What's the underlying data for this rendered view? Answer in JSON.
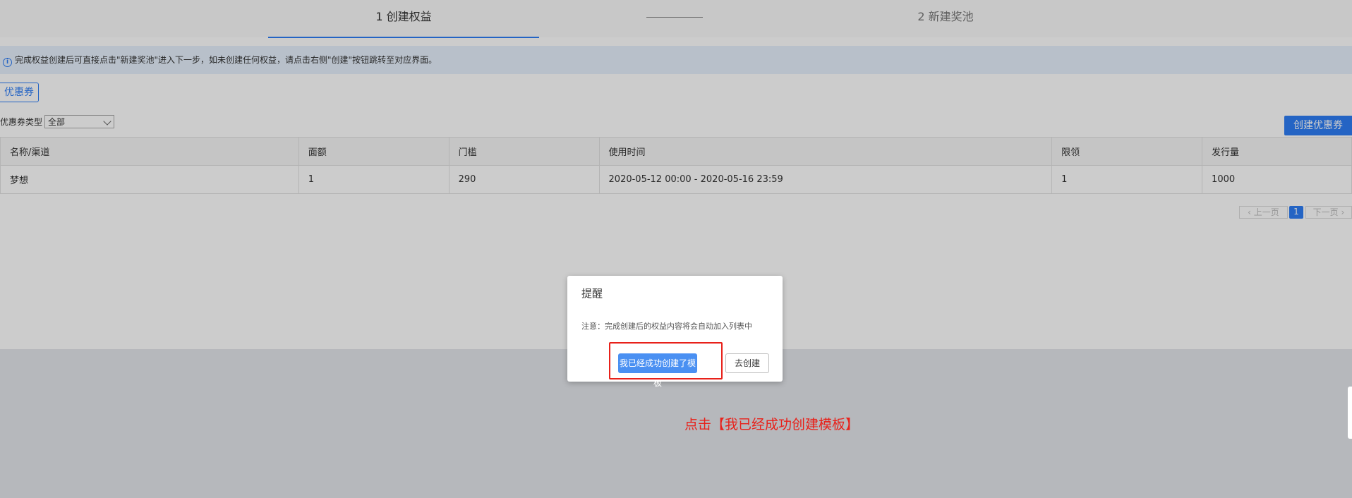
{
  "steps": {
    "step1": "1 创建权益",
    "step2": "2 新建奖池"
  },
  "info": {
    "icon": "info-icon",
    "text": "完成权益创建后可直接点击\"新建奖池\"进入下一步，如未创建任何权益，请点击右侧\"创建\"按钮跳转至对应界面。"
  },
  "tab": {
    "label": "优惠券"
  },
  "filter": {
    "label": "优惠券类型",
    "selected": "全部"
  },
  "toolbar": {
    "create_label": "创建优惠券"
  },
  "table": {
    "headers": [
      "名称/渠道",
      "面额",
      "门槛",
      "使用时间",
      "限领",
      "发行量"
    ],
    "rows": [
      [
        "梦想",
        "1",
        "290",
        "2020-05-12 00:00 - 2020-05-16 23:59",
        "1",
        "1000"
      ]
    ]
  },
  "pagination": {
    "prev": "上一页",
    "current": "1",
    "next": "下一页"
  },
  "dialog": {
    "title": "提醒",
    "message": "注意：完成创建后的权益内容将会自动加入列表中",
    "confirm_label": "我已经成功创建了模板",
    "go_label": "去创建"
  },
  "annotation": {
    "instruction": "点击【我已经成功创建模板】",
    "color": "#e8211a"
  },
  "colors": {
    "accent": "#2e7df6"
  }
}
